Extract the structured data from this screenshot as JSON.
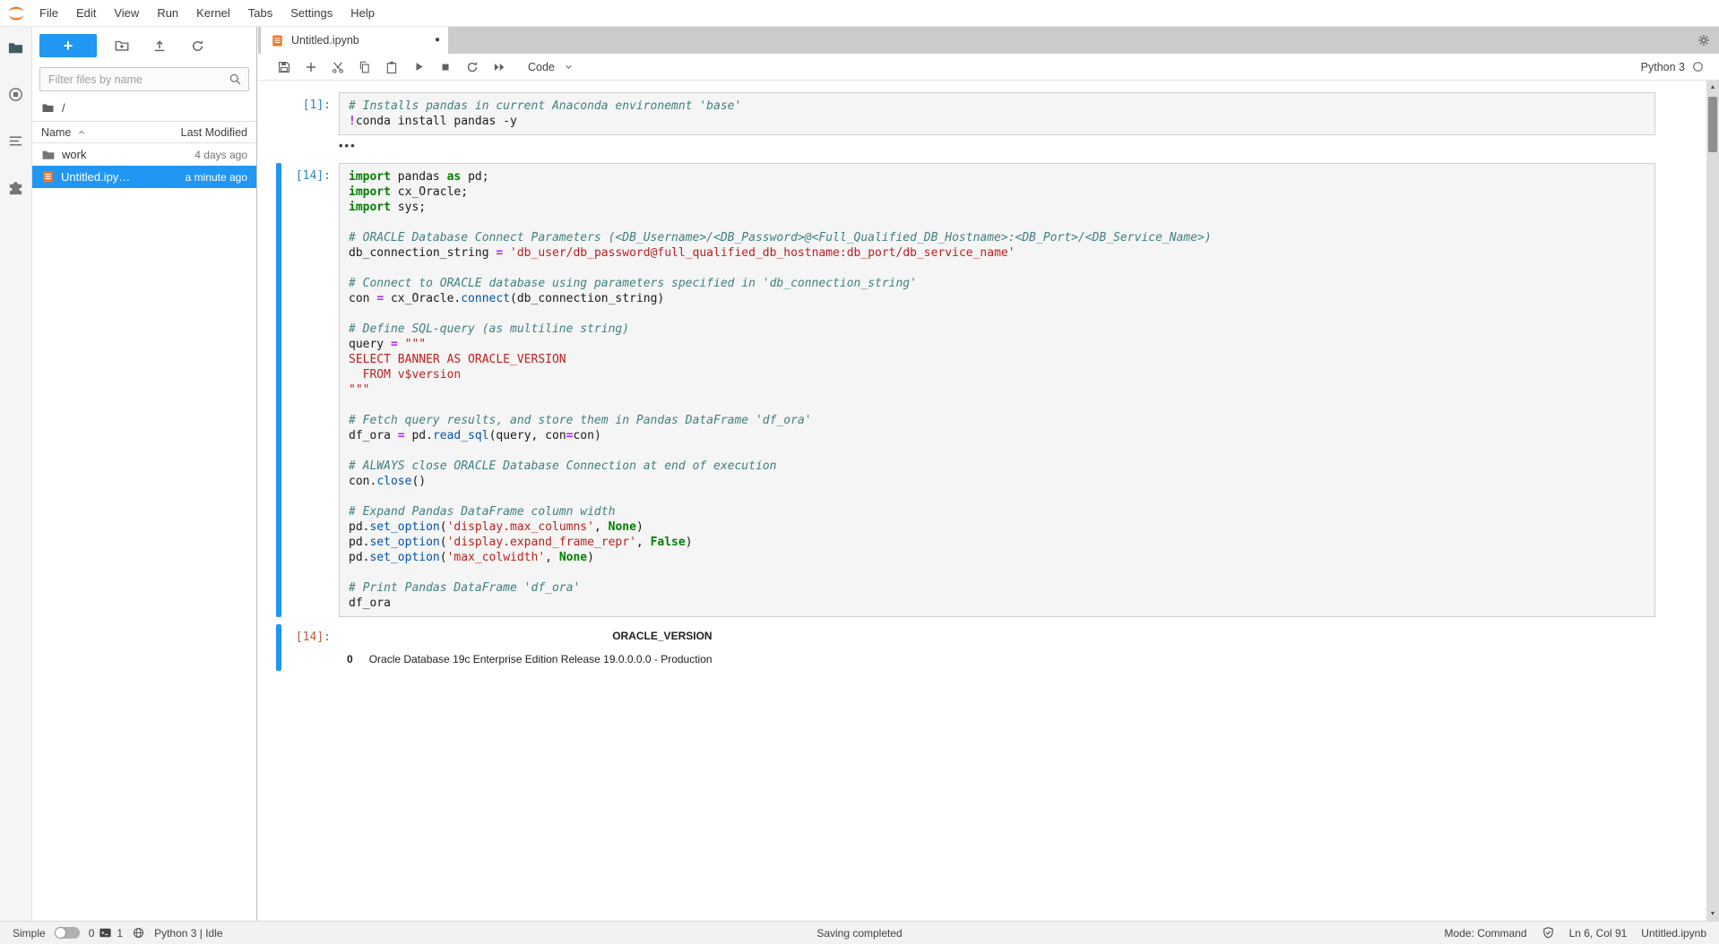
{
  "menu": {
    "items": [
      "File",
      "Edit",
      "View",
      "Run",
      "Kernel",
      "Tabs",
      "Settings",
      "Help"
    ]
  },
  "filebrowser": {
    "new_button": "+",
    "filter_placeholder": "Filter files by name",
    "breadcrumb_root": "/",
    "header": {
      "name": "Name",
      "modified": "Last Modified"
    },
    "rows": [
      {
        "name": "work",
        "modified": "4 days ago",
        "icon": "folder-icon",
        "selected": false
      },
      {
        "name": "Untitled.ipy…",
        "modified": "a minute ago",
        "icon": "notebook-icon",
        "selected": true
      }
    ]
  },
  "tabbar": {
    "title": "Untitled.ipynb",
    "dirty": "●"
  },
  "toolbar": {
    "cell_type": "Code",
    "kernel": "Python 3"
  },
  "cells": {
    "c1": {
      "prompt": "[1]:",
      "collapsed_output": "•••",
      "lines": [
        [
          [
            "c",
            "# Installs pandas in current Anaconda environemnt 'base'"
          ]
        ],
        [
          [
            "o",
            "!"
          ],
          [
            "v",
            "conda install pandas -y"
          ]
        ]
      ]
    },
    "c2": {
      "prompt": "[14]:",
      "out_prompt": "[14]:",
      "lines": [
        [
          [
            "k",
            "import"
          ],
          [
            "v",
            " pandas "
          ],
          [
            "k",
            "as"
          ],
          [
            "v",
            " pd;"
          ]
        ],
        [
          [
            "k",
            "import"
          ],
          [
            "v",
            " cx_Oracle;"
          ]
        ],
        [
          [
            "k",
            "import"
          ],
          [
            "v",
            " sys;"
          ]
        ],
        [],
        [
          [
            "c",
            "# ORACLE Database Connect Parameters (<DB_Username>/<DB_Password>@<Full_Qualified_DB_Hostname>:<DB_Port>/<DB_Service_Name>)"
          ]
        ],
        [
          [
            "v",
            "db_connection_string "
          ],
          [
            "o",
            "="
          ],
          [
            "v",
            " "
          ],
          [
            "s",
            "'db_user/db_password@full_qualified_db_hostname:db_port/db_service_name'"
          ]
        ],
        [],
        [
          [
            "c",
            "# Connect to ORACLE database using parameters specified in 'db_connection_string'"
          ]
        ],
        [
          [
            "v",
            "con "
          ],
          [
            "o",
            "="
          ],
          [
            "v",
            " cx_Oracle."
          ],
          [
            "p",
            "connect"
          ],
          [
            "v",
            "(db_connection_string)"
          ]
        ],
        [],
        [
          [
            "c",
            "# Define SQL-query (as multiline string)"
          ]
        ],
        [
          [
            "v",
            "query "
          ],
          [
            "o",
            "="
          ],
          [
            "v",
            " "
          ],
          [
            "s",
            "\"\"\""
          ]
        ],
        [
          [
            "s",
            "SELECT BANNER AS ORACLE_VERSION"
          ]
        ],
        [
          [
            "s",
            "  FROM v$version"
          ]
        ],
        [
          [
            "s",
            "\"\"\""
          ]
        ],
        [],
        [
          [
            "c",
            "# Fetch query results, and store them in Pandas DataFrame 'df_ora'"
          ]
        ],
        [
          [
            "v",
            "df_ora "
          ],
          [
            "o",
            "="
          ],
          [
            "v",
            " pd."
          ],
          [
            "p",
            "read_sql"
          ],
          [
            "v",
            "(query, con"
          ],
          [
            "o",
            "="
          ],
          [
            "v",
            "con)"
          ]
        ],
        [],
        [
          [
            "c",
            "# ALWAYS close ORACLE Database Connection at end of execution"
          ]
        ],
        [
          [
            "v",
            "con."
          ],
          [
            "p",
            "close"
          ],
          [
            "v",
            "()"
          ]
        ],
        [],
        [
          [
            "c",
            "# Expand Pandas DataFrame column width"
          ]
        ],
        [
          [
            "v",
            "pd."
          ],
          [
            "p",
            "set_option"
          ],
          [
            "v",
            "("
          ],
          [
            "s",
            "'display.max_columns'"
          ],
          [
            "v",
            ", "
          ],
          [
            "k",
            "None"
          ],
          [
            "v",
            ")"
          ]
        ],
        [
          [
            "v",
            "pd."
          ],
          [
            "p",
            "set_option"
          ],
          [
            "v",
            "("
          ],
          [
            "s",
            "'display.expand_frame_repr'"
          ],
          [
            "v",
            ", "
          ],
          [
            "k",
            "False"
          ],
          [
            "v",
            ")"
          ]
        ],
        [
          [
            "v",
            "pd."
          ],
          [
            "p",
            "set_option"
          ],
          [
            "v",
            "("
          ],
          [
            "s",
            "'max_colwidth'"
          ],
          [
            "v",
            ", "
          ],
          [
            "k",
            "None"
          ],
          [
            "v",
            ")"
          ]
        ],
        [],
        [
          [
            "c",
            "# Print Pandas DataFrame 'df_ora'"
          ]
        ],
        [
          [
            "v",
            "df_ora"
          ]
        ]
      ],
      "output": {
        "col": "ORACLE_VERSION",
        "index": "0",
        "value": "Oracle Database 19c Enterprise Edition Release 19.0.0.0.0 - Production"
      }
    }
  },
  "statusbar": {
    "simple": "Simple",
    "kernels": "0",
    "terminals": "1",
    "kernel_status": "Python 3 | Idle",
    "center": "Saving completed",
    "mode": "Mode: Command",
    "cursor": "Ln 6, Col 91",
    "file": "Untitled.ipynb"
  },
  "icons": {
    "scroll_up": "▲",
    "scroll_down": "▼",
    "dirty_dot": "●",
    "collapsed_output": "•••",
    "search": "magnifier-glyph",
    "sort_asc": "chevron-up-glyph",
    "cell_type_caret": "chevron-down-glyph",
    "kernel_idle": "hollow-circle"
  },
  "colors": {
    "accent_blue": "#2196f3",
    "notebook_orange": "#f37726",
    "prompt_in": "#307fc1",
    "prompt_out": "#bf5b3d"
  }
}
